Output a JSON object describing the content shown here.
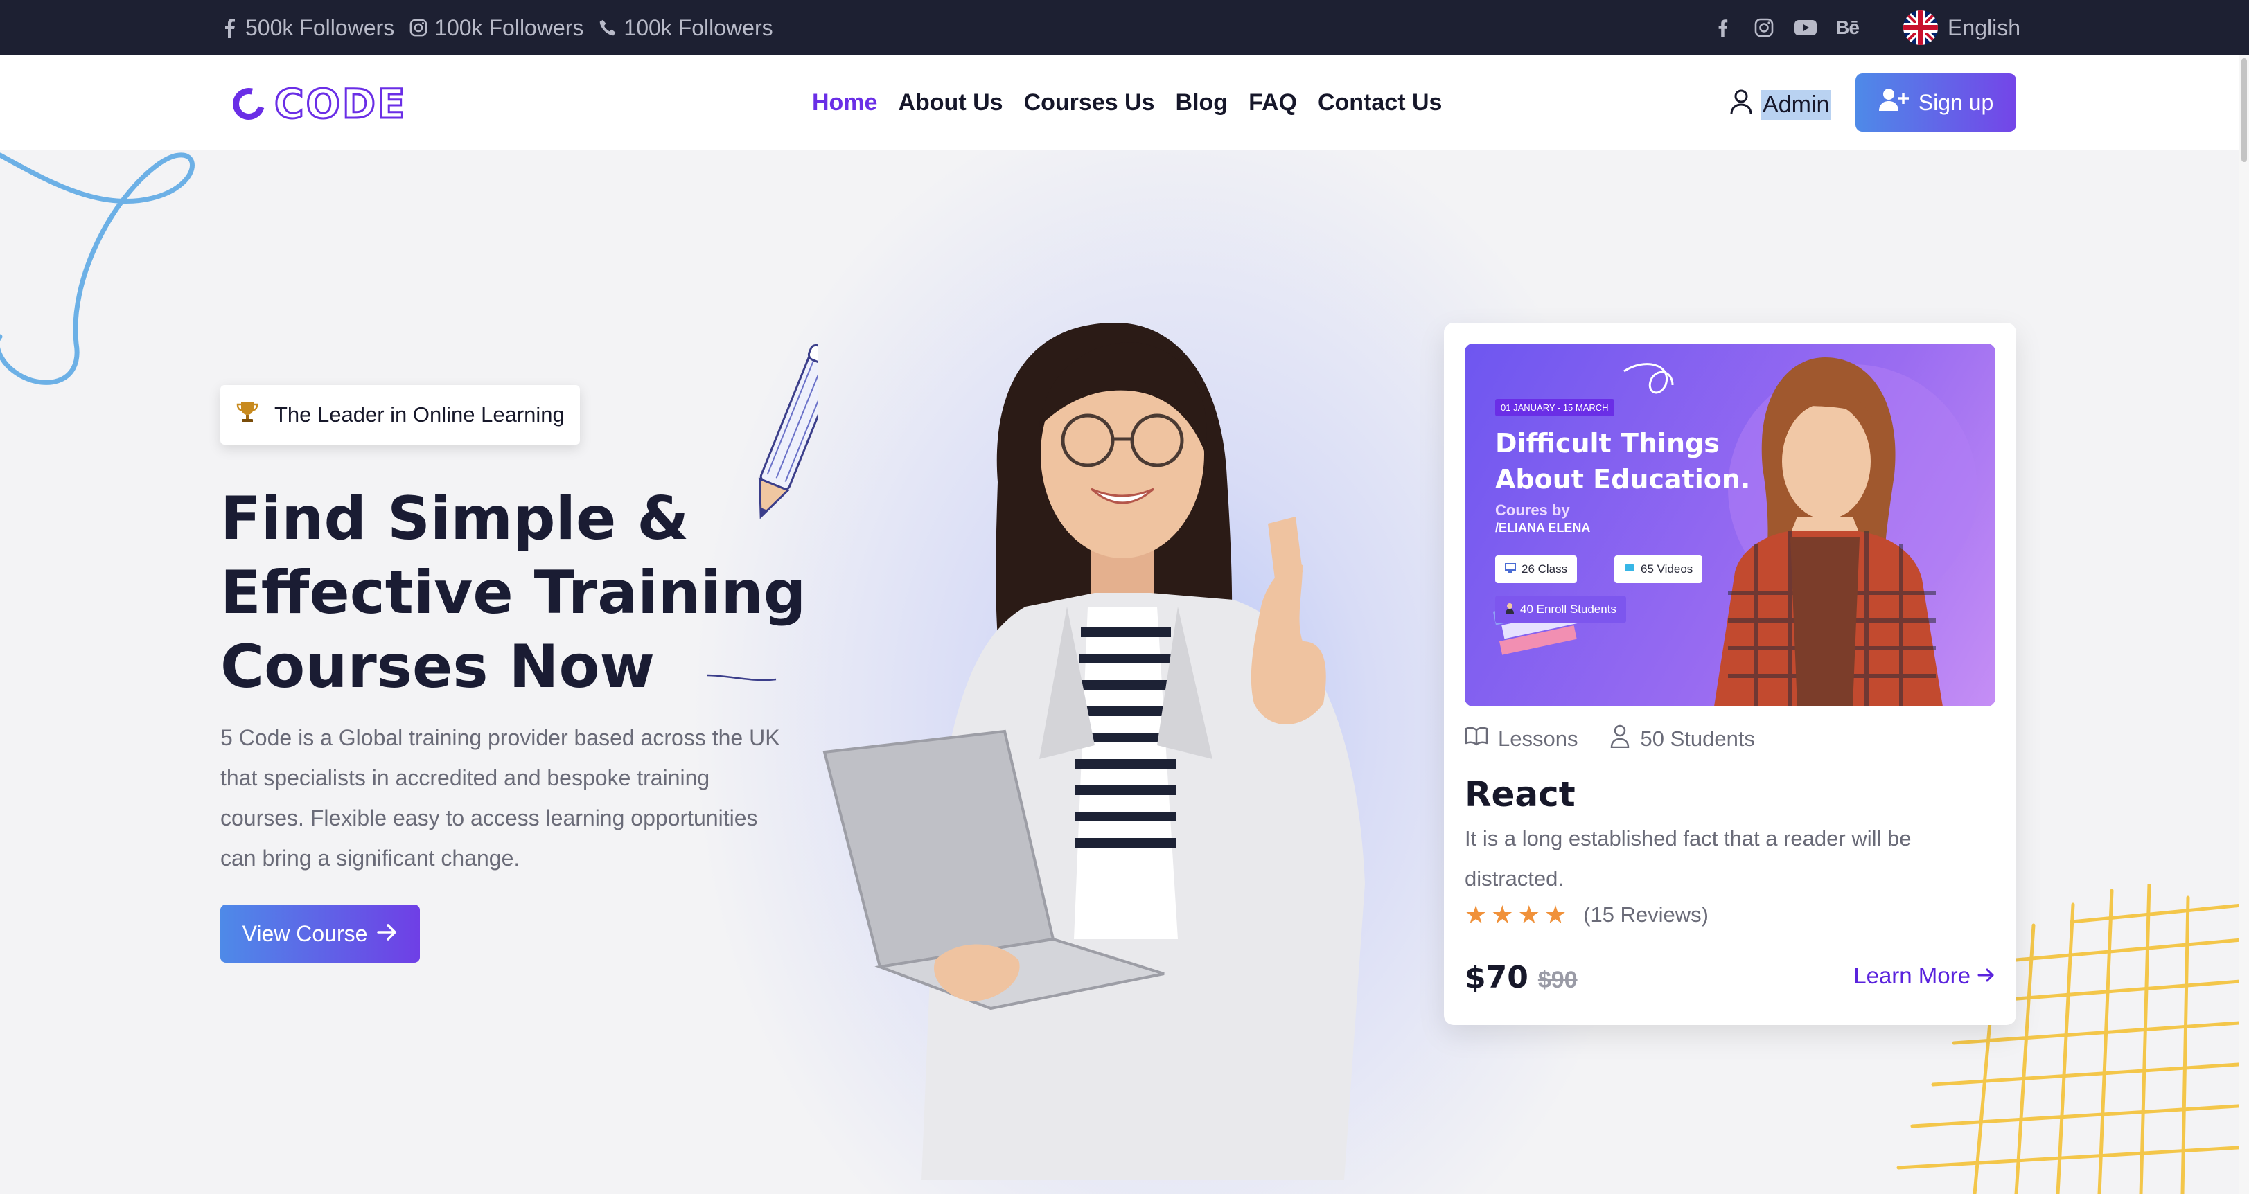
{
  "topbar": {
    "stats": [
      {
        "icon": "facebook-icon",
        "label": "500k Followers"
      },
      {
        "icon": "instagram-icon",
        "label": "100k Followers"
      },
      {
        "icon": "phone-icon",
        "label": "100k Followers"
      }
    ],
    "social_icons": [
      "facebook-icon",
      "instagram-icon",
      "youtube-icon",
      "behance-icon"
    ],
    "behance_text": "Bē",
    "language": "English"
  },
  "header": {
    "logo_text": "CODE",
    "nav": [
      {
        "label": "Home",
        "active": true
      },
      {
        "label": "About Us",
        "active": false
      },
      {
        "label": "Courses Us",
        "active": false
      },
      {
        "label": "Blog",
        "active": false
      },
      {
        "label": "FAQ",
        "active": false
      },
      {
        "label": "Contact Us",
        "active": false
      }
    ],
    "admin_label": "Admin",
    "signup_label": "Sign up"
  },
  "hero": {
    "badge_icon": "trophy-icon",
    "badge_text": "The Leader in Online Learning",
    "title_lines": [
      "Find Simple &",
      "Effective Training",
      "Courses Now"
    ],
    "description": "5 Code is a Global training provider based across the UK that specialists in accredited and bespoke training courses. Flexible easy to access learning opportunities can bring a significant change.",
    "cta_label": "View Course"
  },
  "course_card": {
    "thumb": {
      "date": "01 JANUARY - 15 MARCH",
      "title_lines": [
        "Difficult Things",
        "About Education."
      ],
      "by": "Coures by",
      "author": "/ELIANA ELENA",
      "chips": [
        "26 Class",
        "65 Videos",
        "40 Enroll Students"
      ]
    },
    "lessons_label": "Lessons",
    "students_label": "50 Students",
    "title": "React",
    "description": "It is a long established fact that a reader will be distracted.",
    "rating": 4,
    "reviews_label": "(15 Reviews)",
    "price_now": "$70",
    "price_old": "$90",
    "learn_more_label": "Learn More"
  },
  "colors": {
    "accent": "#6a2ee6",
    "topbar_bg": "#1d2032",
    "star": "#f0913a"
  }
}
